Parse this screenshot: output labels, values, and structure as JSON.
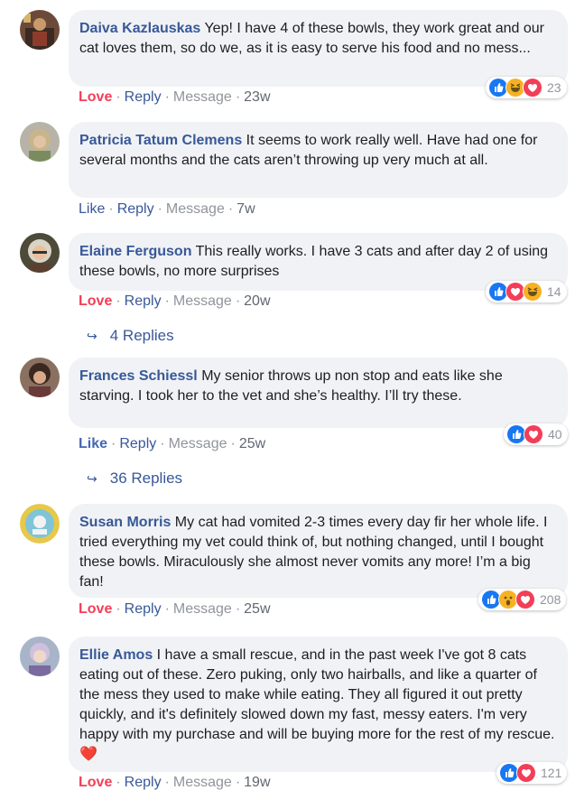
{
  "comments": [
    {
      "name": "Daiva Kazlauskas",
      "text": " Yep! I have 4 of these bowls, they work great and our cat loves them, so do we, as it is easy to serve his food and no mess...",
      "action_like": "Love",
      "reply": "Reply",
      "message": "Message",
      "time": "23w",
      "reaction_count": "23",
      "reactions": [
        "like-icon",
        "haha-icon",
        "love-icon"
      ]
    },
    {
      "name": "Patricia Tatum Clemens",
      "text": " It seems to work really well. Have had one for several months and the cats aren’t throwing up very much at all.",
      "action_like": "Like",
      "reply": "Reply",
      "message": "Message",
      "time": "7w"
    },
    {
      "name": "Elaine Ferguson",
      "text": " This really works. I have 3 cats and after day 2 of using these bowls, no more surprises",
      "action_like": "Love",
      "reply": "Reply",
      "message": "Message",
      "time": "20w",
      "reaction_count": "14",
      "reactions": [
        "like-icon",
        "love-icon",
        "haha-icon"
      ],
      "replies_label": "4 Replies"
    },
    {
      "name": "Frances Schiessl",
      "text": " My senior throws up non stop and eats like she starving. I took her to the vet and she’s healthy. I’ll try these.",
      "action_like": "Like",
      "reply": "Reply",
      "message": "Message",
      "time": "25w",
      "reaction_count": "40",
      "reactions": [
        "like-icon",
        "love-icon"
      ],
      "replies_label": "36 Replies"
    },
    {
      "name": "Susan Morris",
      "text": " My cat had vomited 2-3 times every day fir her whole life. I tried everything my vet could think of, but nothing changed, until I bought these bowls. Miraculously she almost never vomits any more! I’m a big fan!",
      "action_like": "Love",
      "reply": "Reply",
      "message": "Message",
      "time": "25w",
      "reaction_count": "208",
      "reactions": [
        "like-icon",
        "wow-icon",
        "love-icon"
      ]
    },
    {
      "name": "Ellie Amos",
      "text": " I have a small rescue, and in the past week I've got 8 cats eating out of these. Zero puking, only two hairballs, and like a quarter of the mess they used to make while eating. They all figured it out pretty quickly, and it's definitely slowed down my fast, messy eaters. I'm very happy with my purchase and will be buying more for the rest of my rescue.",
      "emoji": "❤️",
      "action_like": "Love",
      "reply": "Reply",
      "message": "Message",
      "time": "19w",
      "reaction_count": "121",
      "reactions": [
        "like-icon",
        "love-icon"
      ]
    }
  ],
  "colors": {
    "name": "#385898",
    "love": "#f33e58",
    "like": "#4267b2",
    "bubble": "#f0f2f5",
    "meta": "#90949c"
  }
}
